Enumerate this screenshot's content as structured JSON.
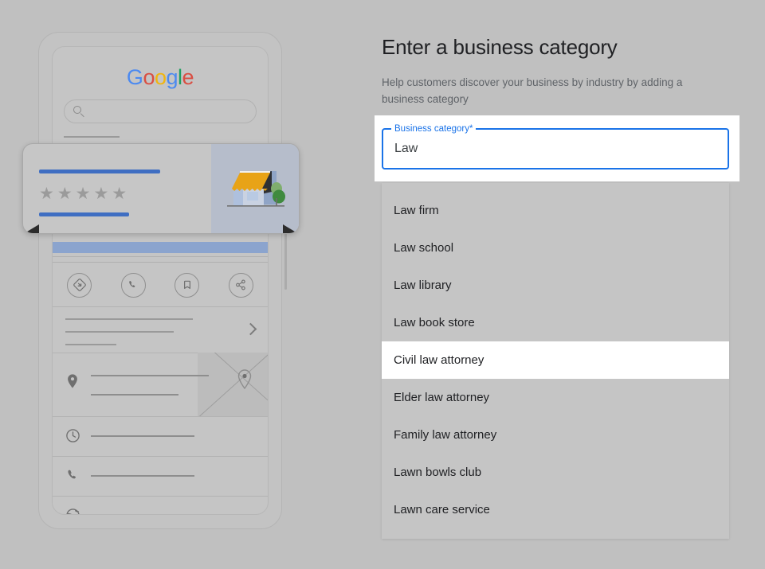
{
  "page": {
    "background_color": "#c0c0c0"
  },
  "form": {
    "title": "Enter a business category",
    "subtitle": "Help customers discover your business by industry by adding a business category",
    "field": {
      "label": "Business category*",
      "value": "Law",
      "placeholder": "",
      "accent_color": "#1a73e8"
    },
    "dropdown": {
      "items": [
        {
          "label": "Law firm",
          "selected": false
        },
        {
          "label": "Law school",
          "selected": false
        },
        {
          "label": "Law library",
          "selected": false
        },
        {
          "label": "Law book store",
          "selected": false
        },
        {
          "label": "Civil law attorney",
          "selected": true
        },
        {
          "label": "Elder law attorney",
          "selected": false
        },
        {
          "label": "Family law attorney",
          "selected": false
        },
        {
          "label": "Lawn bowls club",
          "selected": false
        },
        {
          "label": "Lawn care service",
          "selected": false
        }
      ]
    }
  },
  "phone_preview": {
    "brand": {
      "letters": [
        {
          "char": "G",
          "color": "#4285F4"
        },
        {
          "char": "o",
          "color": "#DB4437"
        },
        {
          "char": "o",
          "color": "#F4B400"
        },
        {
          "char": "g",
          "color": "#4285F4"
        },
        {
          "char": "l",
          "color": "#0F9D58"
        },
        {
          "char": "e",
          "color": "#DB4437"
        }
      ]
    },
    "search_bar": {
      "icon": "search-icon",
      "value": "",
      "placeholder": ""
    },
    "business_card": {
      "rating_stars": "★★★★★",
      "star_count": 5,
      "accent_color": "#3f6ec2",
      "illustration": "storefront-illustration"
    },
    "action_icons": [
      {
        "name": "directions-icon"
      },
      {
        "name": "call-icon"
      },
      {
        "name": "save-bookmark-icon"
      },
      {
        "name": "share-icon"
      }
    ],
    "info_rows": [
      {
        "icon": "location-pin-icon"
      },
      {
        "icon": "clock-icon"
      },
      {
        "icon": "phone-icon"
      },
      {
        "icon": "globe-icon"
      }
    ]
  }
}
